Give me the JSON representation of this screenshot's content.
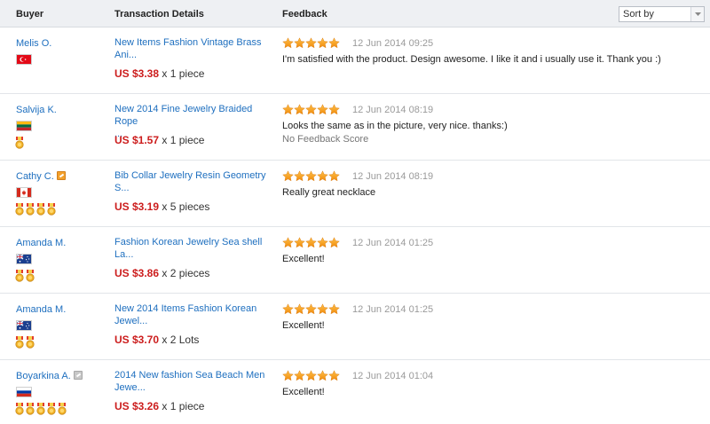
{
  "header": {
    "buyer": "Buyer",
    "transaction": "Transaction Details",
    "feedback": "Feedback",
    "sort_label": "Sort by"
  },
  "colors": {
    "link": "#1e6fbf",
    "price": "#cc1d1d",
    "star": "#f39c12"
  },
  "rows": [
    {
      "buyer": "Melis O.",
      "country_flag": "turkey",
      "tag_icon": "",
      "medals": 0,
      "title_line1": "New Items Fashion Vintage Brass",
      "title_line2": "Ani...",
      "price": "US $3.38",
      "qty": "x 1 piece",
      "rating": 5,
      "date": "12 Jun 2014 09:25",
      "comment": "I'm satisfied with the product. Design awesome. I like it and i usually use it. Thank you :)",
      "note": ""
    },
    {
      "buyer": "Salvija K.",
      "country_flag": "lithuania",
      "tag_icon": "",
      "medals": 1,
      "title_line1": "New 2014 Fine Jewelry Braided Rope",
      "title_line2": "...",
      "price": "US $1.57",
      "qty": "x 1 piece",
      "rating": 5,
      "date": "12 Jun 2014 08:19",
      "comment": "Looks the same as in the picture, very nice. thanks:)",
      "note": "No Feedback Score"
    },
    {
      "buyer": "Cathy C.",
      "country_flag": "canada",
      "tag_icon": "orange",
      "medals": 4,
      "title_line1": "Bib Collar Jewelry Resin Geometry S...",
      "title_line2": "",
      "price": "US $3.19",
      "qty": "x 5 pieces",
      "rating": 5,
      "date": "12 Jun 2014 08:19",
      "comment": "Really great necklace",
      "note": ""
    },
    {
      "buyer": "Amanda M.",
      "country_flag": "australia",
      "tag_icon": "",
      "medals": 2,
      "title_line1": "Fashion Korean Jewelry Sea shell",
      "title_line2": "La...",
      "price": "US $3.86",
      "qty": "x 2 pieces",
      "rating": 5,
      "date": "12 Jun 2014 01:25",
      "comment": "Excellent!",
      "note": ""
    },
    {
      "buyer": "Amanda M.",
      "country_flag": "australia",
      "tag_icon": "",
      "medals": 2,
      "title_line1": "New 2014 Items Fashion Korean",
      "title_line2": "Jewel...",
      "price": "US $3.70",
      "qty": "x 2 Lots",
      "rating": 5,
      "date": "12 Jun 2014 01:25",
      "comment": "Excellent!",
      "note": ""
    },
    {
      "buyer": "Boyarkina A.",
      "country_flag": "russia",
      "tag_icon": "gray",
      "medals": 5,
      "title_line1": "2014 New fashion Sea Beach Men",
      "title_line2": "Jewe...",
      "price": "US $3.26",
      "qty": "x 1 piece",
      "rating": 5,
      "date": "12 Jun 2014 01:04",
      "comment": "Excellent!",
      "note": ""
    }
  ]
}
